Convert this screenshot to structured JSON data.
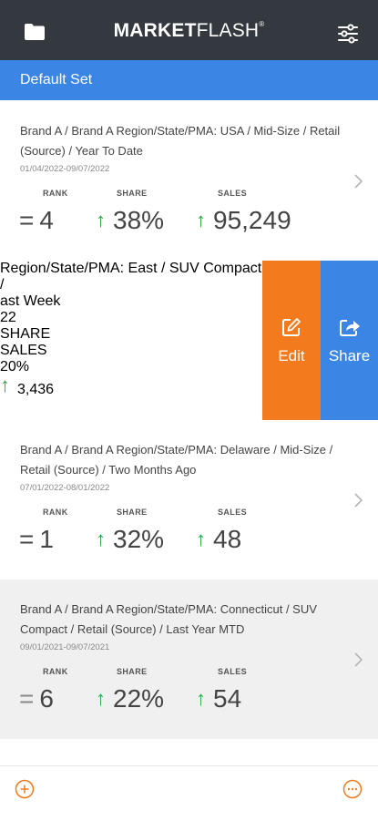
{
  "app": {
    "brand_bold": "MARKET",
    "brand_light": "FLASH",
    "brand_mark": "®"
  },
  "set": {
    "name": "Default Set"
  },
  "labels": {
    "rank": "RANK",
    "share": "SHARE",
    "sales": "SALES"
  },
  "actions": {
    "edit": "Edit",
    "share": "Share"
  },
  "colors": {
    "header": "#34383f",
    "accent_blue": "#3b86e4",
    "edit_orange": "#f37b1d",
    "trend_up": "#28a745",
    "bottom_icon": "#f37b1d"
  },
  "icons": {
    "top_left": "folder-icon",
    "top_right": "filter-sliders-icon",
    "card_action": "chevron-right-icon",
    "bottom_left": "add-circle-icon",
    "bottom_right": "more-circle-icon"
  },
  "cards": [
    {
      "title_line1": "Brand A / Brand A Region/State/PMA: USA / Mid-Size / Retail",
      "title_line2": "(Source) / Year To Date",
      "date": "01/04/2022-09/07/2022",
      "rank_prefix": "=",
      "rank": "4",
      "share_trend": "↑",
      "share": "38%",
      "sales_trend": "↑",
      "sales": "95,249"
    },
    {
      "title_line1": " Region/State/PMA: East / SUV Compact /",
      "title_line2": "ast Week",
      "date": "22",
      "share": "20%",
      "sales_trend": "↑",
      "sales": "3,436"
    },
    {
      "title_line1": "Brand A / Brand A Region/State/PMA: Delaware / Mid-Size /",
      "title_line2": "Retail (Source) / Two Months Ago",
      "date": "07/01/2022-08/01/2022",
      "rank_prefix": "=",
      "rank": "1",
      "share_trend": "↑",
      "share": "32%",
      "sales_trend": "↑",
      "sales": "48"
    },
    {
      "title_line1": "Brand A / Brand A Region/State/PMA: Connecticut / SUV",
      "title_line2": "Compact / Retail (Source) / Last Year MTD",
      "date": "09/01/2021-09/07/2021",
      "rank_prefix": "=",
      "rank": "6",
      "share_trend": "↑",
      "share": "22%",
      "sales_trend": "↑",
      "sales": "54"
    }
  ]
}
